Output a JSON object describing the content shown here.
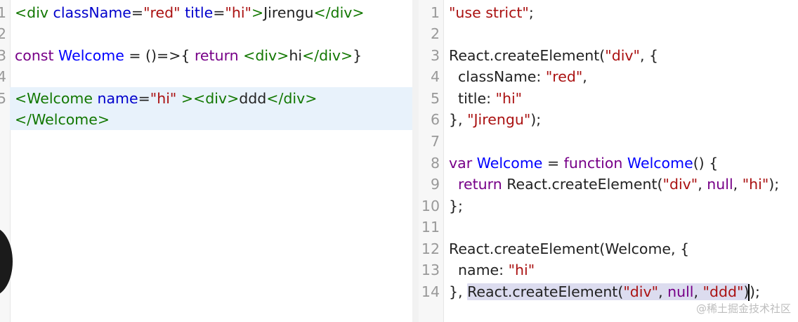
{
  "left": {
    "line_numbers": [
      "1",
      "2",
      "3",
      "4",
      "5",
      ""
    ],
    "lines": [
      [
        [
          "tag",
          "<div "
        ],
        [
          "attr",
          "className"
        ],
        [
          "op",
          "="
        ],
        [
          "str",
          "\"red\""
        ],
        [
          "text",
          " "
        ],
        [
          "attr",
          "title"
        ],
        [
          "op",
          "="
        ],
        [
          "str",
          "\"hi\""
        ],
        [
          "tag",
          ">"
        ],
        [
          "text",
          "Jirengu"
        ],
        [
          "tag",
          "</div>"
        ]
      ],
      [],
      [
        [
          "kw",
          "const "
        ],
        [
          "def",
          "Welcome"
        ],
        [
          "op",
          " = ()=>{ "
        ],
        [
          "kw",
          "return "
        ],
        [
          "tag",
          "<div>"
        ],
        [
          "text",
          "hi"
        ],
        [
          "tag",
          "</div>"
        ],
        [
          "op",
          "}"
        ]
      ],
      [],
      [
        [
          "tag",
          "<Welcome "
        ],
        [
          "attr",
          "name"
        ],
        [
          "op",
          "="
        ],
        [
          "str",
          "\"hi\""
        ],
        [
          "text",
          " "
        ],
        [
          "tag",
          "><div>"
        ],
        [
          "text",
          "ddd"
        ],
        [
          "tag",
          "</div>"
        ]
      ],
      [
        [
          "tag",
          "</Welcome>"
        ]
      ]
    ]
  },
  "right": {
    "line_numbers": [
      "1",
      "2",
      "3",
      "4",
      "5",
      "6",
      "7",
      "8",
      "9",
      "10",
      "11",
      "12",
      "13",
      "14"
    ],
    "lines": [
      [
        [
          "str",
          "\"use strict\""
        ],
        [
          "op",
          ";"
        ]
      ],
      [],
      [
        [
          "var",
          "React.createElement("
        ],
        [
          "str",
          "\"div\""
        ],
        [
          "op",
          ", {"
        ]
      ],
      [
        [
          "var",
          "  className: "
        ],
        [
          "str",
          "\"red\""
        ],
        [
          "op",
          ","
        ]
      ],
      [
        [
          "var",
          "  title: "
        ],
        [
          "str",
          "\"hi\""
        ]
      ],
      [
        [
          "op",
          "}, "
        ],
        [
          "str",
          "\"Jirengu\""
        ],
        [
          "op",
          ");"
        ]
      ],
      [],
      [
        [
          "kw2",
          "var "
        ],
        [
          "def",
          "Welcome"
        ],
        [
          "op",
          " = "
        ],
        [
          "kw2",
          "function "
        ],
        [
          "def",
          "Welcome"
        ],
        [
          "op",
          "() {"
        ]
      ],
      [
        [
          "kw2",
          "  return "
        ],
        [
          "var",
          "React.createElement("
        ],
        [
          "str",
          "\"div\""
        ],
        [
          "op",
          ", "
        ],
        [
          "kw2",
          "null"
        ],
        [
          "op",
          ", "
        ],
        [
          "str",
          "\"hi\""
        ],
        [
          "op",
          ");"
        ]
      ],
      [
        [
          "op",
          "};"
        ]
      ],
      [],
      [
        [
          "var",
          "React.createElement(Welcome, {"
        ]
      ],
      [
        [
          "var",
          "  name: "
        ],
        [
          "str",
          "\"hi\""
        ]
      ],
      [
        [
          "op",
          "}, "
        ],
        [
          "sel-start",
          ""
        ],
        [
          "var",
          "React.createElement("
        ],
        [
          "str",
          "\"div\""
        ],
        [
          "op",
          ", "
        ],
        [
          "kw2",
          "null"
        ],
        [
          "op",
          ", "
        ],
        [
          "str",
          "\"ddd\""
        ],
        [
          "op",
          ")"
        ],
        [
          "sel-end",
          ""
        ],
        [
          "caret",
          ""
        ],
        [
          "op",
          ");"
        ]
      ]
    ]
  },
  "watermark": "@稀土掘金技术社区"
}
